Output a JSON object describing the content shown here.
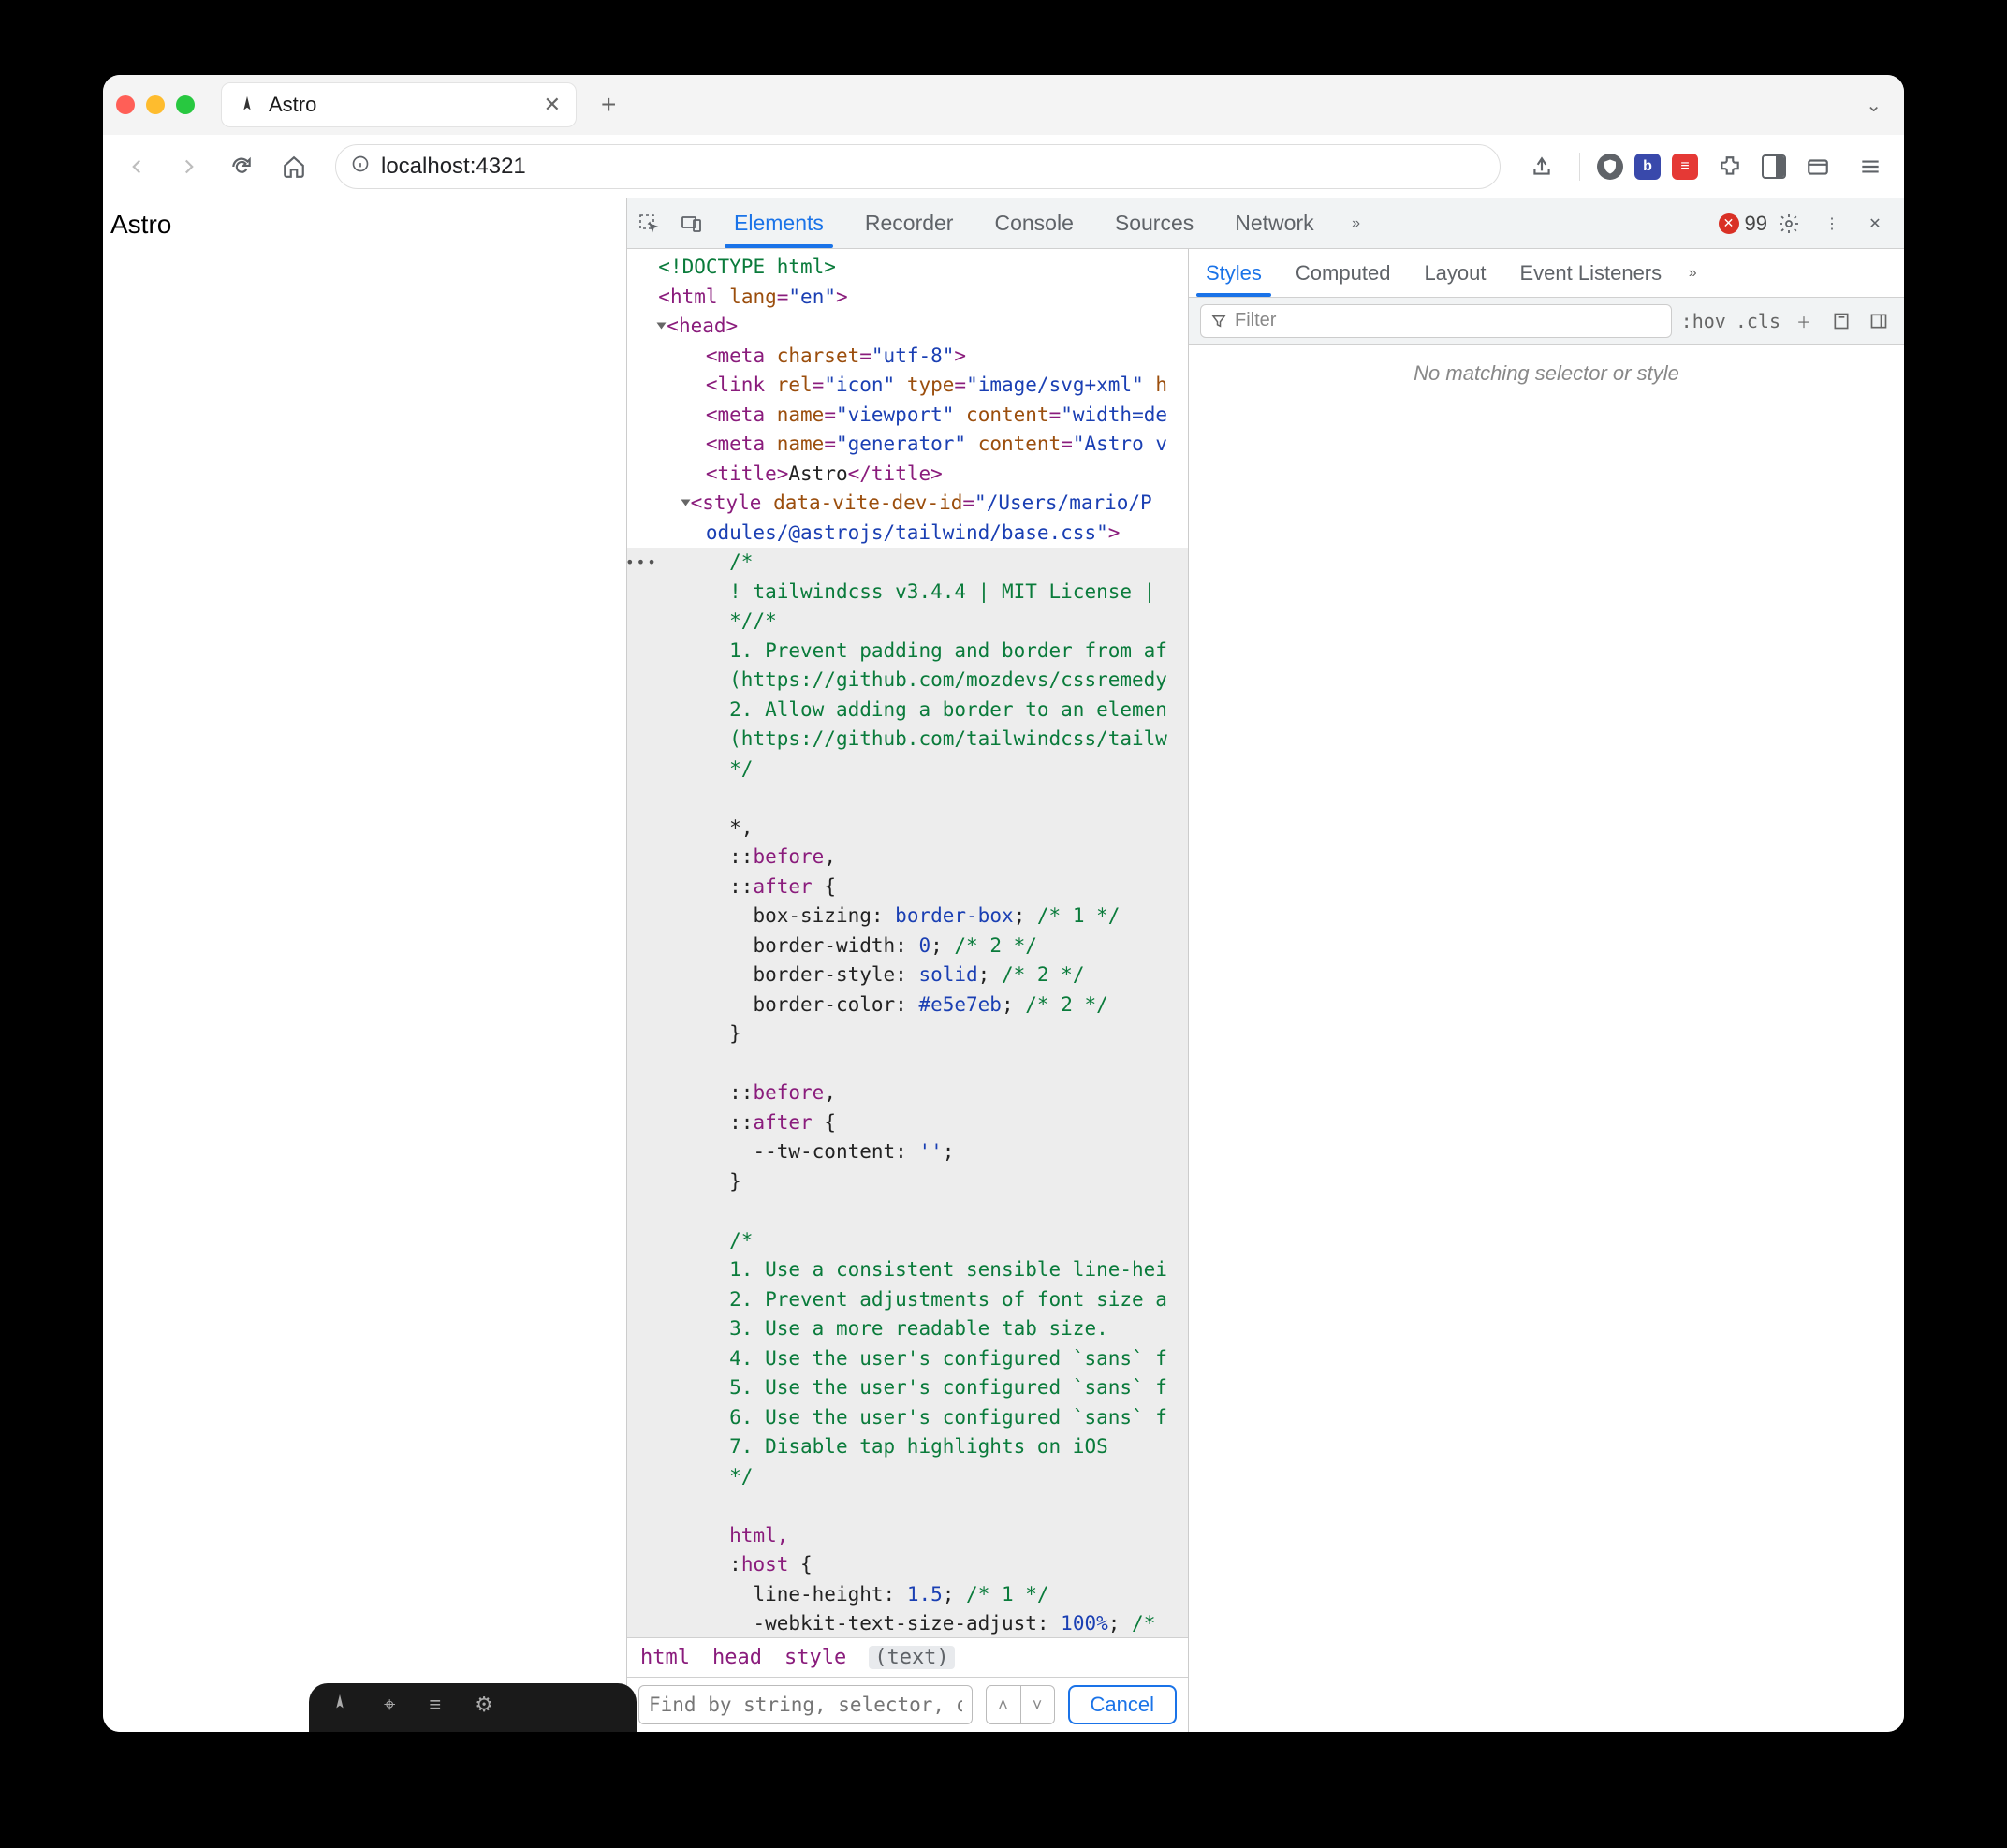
{
  "browser": {
    "tab_title": "Astro",
    "url": "localhost:4321"
  },
  "page_content": "Astro",
  "devtools": {
    "panels": [
      "Elements",
      "Recorder",
      "Console",
      "Sources",
      "Network"
    ],
    "active_panel": "Elements",
    "error_count": "99",
    "styles_panels": [
      "Styles",
      "Computed",
      "Layout",
      "Event Listeners"
    ],
    "styles_active": "Styles",
    "filter_placeholder": "Filter",
    "hov": ":hov",
    "cls": ".cls",
    "no_match": "No matching selector or style",
    "breadcrumbs": [
      "html",
      "head",
      "style",
      "(text)"
    ],
    "search_placeholder": "Find by string, selector, or",
    "cancel": "Cancel"
  },
  "dom": {
    "l01": "<!DOCTYPE html>",
    "l02a": "<",
    "l02b": "html ",
    "l02c": "lang",
    "l02d": "=",
    "l02e": "\"en\"",
    "l02f": ">",
    "l03a": "<",
    "l03b": "head",
    "l03c": ">",
    "l04a": "<",
    "l04b": "meta ",
    "l04c": "charset",
    "l04d": "=",
    "l04e": "\"utf-8\"",
    "l04f": ">",
    "l05a": "<",
    "l05b": "link ",
    "l05c": "rel",
    "l05d": "=",
    "l05e": "\"icon\" ",
    "l05f": "type",
    "l05g": "=",
    "l05h": "\"image/svg+xml\" ",
    "l05i": "h",
    "l06a": "<",
    "l06b": "meta ",
    "l06c": "name",
    "l06d": "=",
    "l06e": "\"viewport\" ",
    "l06f": "content",
    "l06g": "=",
    "l06h": "\"width=de",
    "l07a": "<",
    "l07b": "meta ",
    "l07c": "name",
    "l07d": "=",
    "l07e": "\"generator\" ",
    "l07f": "content",
    "l07g": "=",
    "l07h": "\"Astro v",
    "l08a": "<",
    "l08b": "title",
    "l08c": ">",
    "l08d": "Astro",
    "l08e": "</",
    "l08f": "title",
    "l08g": ">",
    "l09a": "<",
    "l09b": "style ",
    "l09c": "data-vite-dev-id",
    "l09d": "=",
    "l09e": "\"/Users/mario/P",
    "l10": "odules/@astrojs/tailwind/base.css\"",
    "l10b": ">",
    "c01": "/*",
    "c02": "! tailwindcss v3.4.4 | MIT License |",
    "c03": "*//*",
    "c04": "1. Prevent padding and border from af",
    "c05": "(https://github.com/mozdevs/cssremedy",
    "c06": "2. Allow adding a border to an elemen",
    "c07": "(https://github.com/tailwindcss/tailw",
    "c08": "*/",
    "s01": "*,",
    "s02a": "::",
    "s02b": "before",
    "s02c": ",",
    "s03a": "::",
    "s03b": "after",
    "s03c": " {",
    "p01a": "  box-sizing: ",
    "p01b": "border-box",
    "p01c": "; ",
    "p01d": "/* 1 */",
    "p02a": "  border-width: ",
    "p02b": "0",
    "p02c": "; ",
    "p02d": "/* 2 */",
    "p03a": "  border-style: ",
    "p03b": "solid",
    "p03c": "; ",
    "p03d": "/* 2 */",
    "p04a": "  border-color: ",
    "p04b": "#e5e7eb",
    "p04c": "; ",
    "p04d": "/* 2 */",
    "br1": "}",
    "s04a": "::",
    "s04b": "before",
    "s04c": ",",
    "s05a": "::",
    "s05b": "after",
    "s05c": " {",
    "p05a": "  --tw-content: ",
    "p05b": "''",
    "p05c": ";",
    "br2": "}",
    "c10": "/*",
    "c11": "1. Use a consistent sensible line-hei",
    "c12": "2. Prevent adjustments of font size a",
    "c13": "3. Use a more readable tab size.",
    "c14": "4. Use the user's configured `sans` f",
    "c15": "5. Use the user's configured `sans` f",
    "c16": "6. Use the user's configured `sans` f",
    "c17": "7. Disable tap highlights on iOS",
    "c18": "*/",
    "s06": "html,",
    "s07a": ":",
    "s07b": "host",
    "s07c": " {",
    "p06a": "  line-height: ",
    "p06b": "1.5",
    "p06c": "; ",
    "p06d": "/* 1 */",
    "p07a": "  -webkit-text-size-adjust: ",
    "p07b": "100%",
    "p07c": "; ",
    "p07d": "/*"
  }
}
